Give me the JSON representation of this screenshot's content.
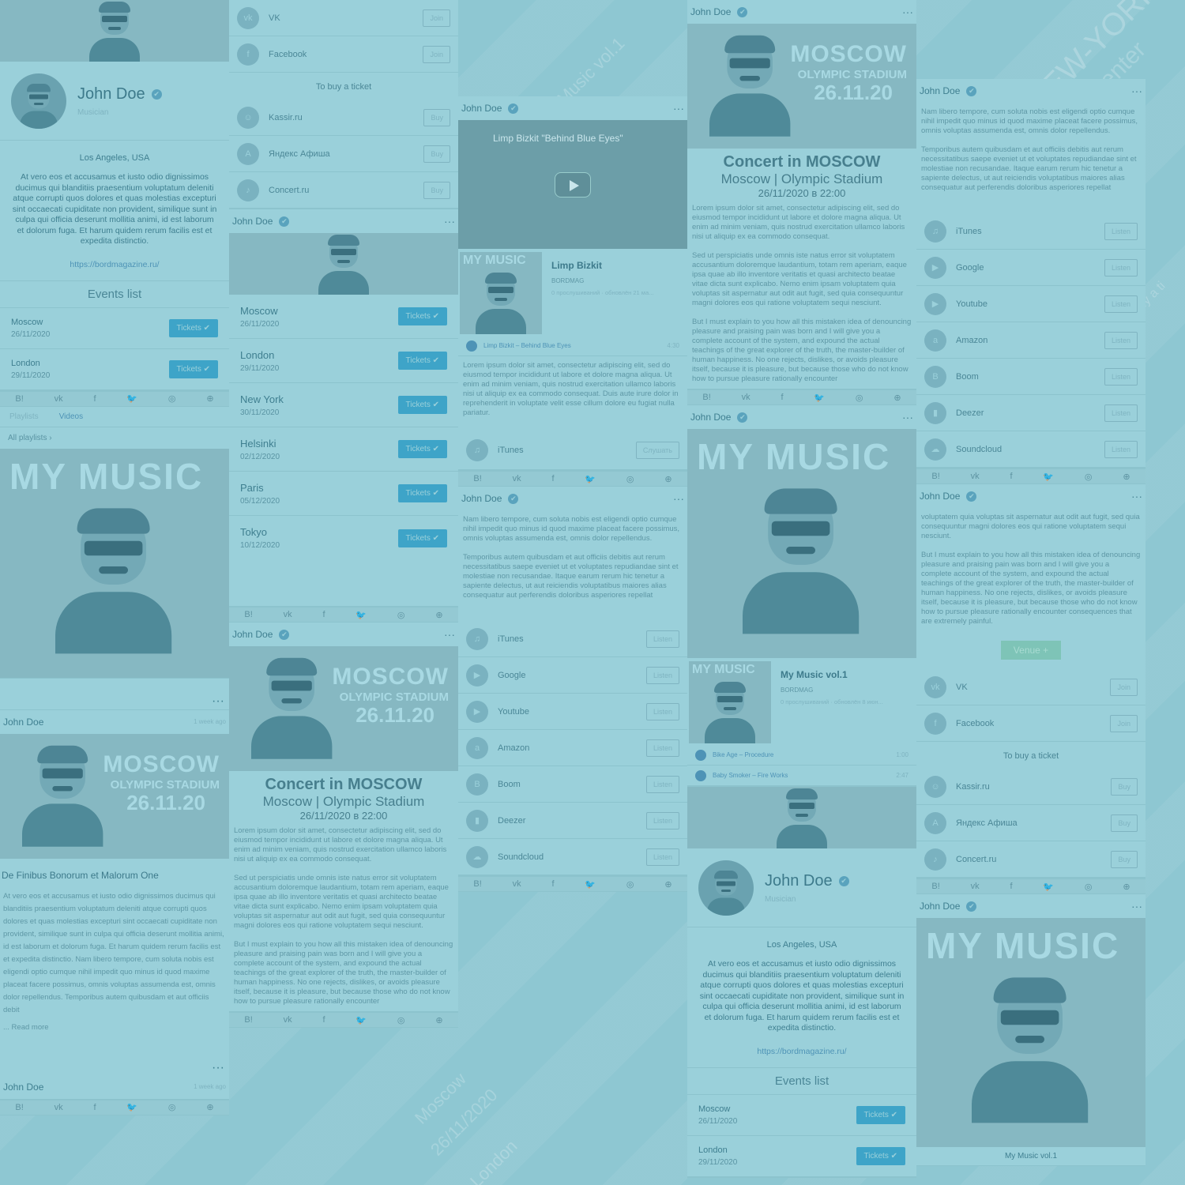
{
  "profile": {
    "name": "John Doe",
    "role": "Musician",
    "location": "Los Angeles, USA",
    "bio": "At vero eos et accusamus et iusto odio dignissimos ducimus qui blanditiis praesentium voluptatum deleniti atque corrupti quos dolores et quas molestias excepturi sint occaecati cupiditate non provident, similique sunt in culpa qui officia deserunt mollitia animi, id est laborum et dolorum fuga. Et harum quidem rerum facilis est et expedita distinctio.",
    "link": "https://bordmagazine.ru/",
    "verified_glyph": "✔"
  },
  "events": {
    "title": "Events list",
    "button_label": "Tickets ✔",
    "items": [
      {
        "city": "Moscow",
        "date": "26/11/2020"
      },
      {
        "city": "London",
        "date": "29/11/2020"
      },
      {
        "city": "New York",
        "date": "30/11/2020"
      },
      {
        "city": "Helsinki",
        "date": "02/12/2020"
      },
      {
        "city": "Paris",
        "date": "05/12/2020"
      },
      {
        "city": "Tokyo",
        "date": "10/12/2020"
      }
    ]
  },
  "social_icons": [
    "bord-icon",
    "vk-icon",
    "facebook-icon",
    "twitter-icon",
    "instagram-icon",
    "login-icon"
  ],
  "social_glyphs": [
    "B!",
    "vk",
    "f",
    "🐦",
    "◎",
    "⊕"
  ],
  "tabs": {
    "playlists": "Playlists",
    "videos": "Videos",
    "all_playlists": "All playlists ›"
  },
  "my_music": {
    "title": "MY MUSIC",
    "album": "My Music vol.1",
    "label": "BORDMAG",
    "meta_a": "0 прослушиваний · обновлён 8 июн...",
    "meta_b": "0 прослушиваний · обновлён 21 ма...",
    "tracks": [
      {
        "title": "Bike Age – Procedure",
        "time": "1:00"
      },
      {
        "title": "Baby Smoker – Fire Works",
        "time": "2:47"
      }
    ]
  },
  "post": {
    "author": "John Doe",
    "time_ago": "1 week ago",
    "more": "···",
    "article_title": "De Finibus Bonorum et Malorum One",
    "article_body": "At vero eos et accusamus et iusto odio dignissimos ducimus qui blanditiis praesentium voluptatum deleniti atque corrupti quos dolores et quas molestias excepturi sint occaecati cupiditate non provident, similique sunt in culpa qui officia deserunt mollitia animi, id est laborum et dolorum fuga. Et harum quidem rerum facilis est et expedita distinctio. Nam libero tempore, cum soluta nobis est eligendi optio cumque nihil impedit quo minus id quod maxime placeat facere possimus, omnis voluptas assumenda est, omnis dolor repellendus. Temporibus autem quibusdam et aut officiis debit",
    "read_more": "... Read more"
  },
  "communities": {
    "join_label": "Join",
    "items": [
      {
        "name": "VK",
        "icon": "vk-icon"
      },
      {
        "name": "Facebook",
        "icon": "facebook-icon"
      }
    ]
  },
  "tickets": {
    "title": "To buy a ticket",
    "buy_label": "Buy",
    "items": [
      {
        "name": "Kassir.ru",
        "icon": "kassir-icon"
      },
      {
        "name": "Яндекс Афиша",
        "icon": "yandex-afisha-icon"
      },
      {
        "name": "Concert.ru",
        "icon": "concert-icon"
      }
    ]
  },
  "concert": {
    "poster_city": "MOSCOW",
    "poster_venue": "OLYMPIC STADIUM",
    "poster_date": "26.11.20",
    "title": "Concert in MOSCOW",
    "subtitle": "Moscow | Olympic Stadium",
    "datetime": "26/11/2020 в 22:00",
    "p1": "Lorem ipsum dolor sit amet, consectetur adipiscing elit, sed do eiusmod tempor incididunt ut labore et dolore magna aliqua. Ut enim ad minim veniam, quis nostrud exercitation ullamco laboris nisi ut aliquip ex ea commodo consequat.",
    "p2": "Sed ut perspiciatis unde omnis iste natus error sit voluptatem accusantium doloremque laudantium, totam rem aperiam, eaque ipsa quae ab illo inventore veritatis et quasi architecto beatae vitae dicta sunt explicabo. Nemo enim ipsam voluptatem quia voluptas sit aspernatur aut odit aut fugit, sed quia consequuntur magni dolores eos qui ratione voluptatem sequi nesciunt.",
    "p3": "But I must explain to you how all this mistaken idea of denouncing pleasure and praising pain was born and I will give you a complete account of the system, and expound the actual teachings of the great explorer of the truth, the master-builder of human happiness. No one rejects, dislikes, or avoids pleasure itself, because it is pleasure, but because those who do not know how to pursue pleasure rationally encounter"
  },
  "video": {
    "title": "Limp Bizkit \"Behind Blue Eyes\"",
    "artist": "Limp Bizkit",
    "label": "BORDMAG",
    "meta": "0 прослушиваний · обновлён 21 ма...",
    "track": "Limp Bizkit – Behind Blue Eyes",
    "track_time": "4:30"
  },
  "video_desc": "Lorem ipsum dolor sit amet, consectetur adipiscing elit, sed do eiusmod tempor incididunt ut labore et dolore magna aliqua. Ut enim ad minim veniam, quis nostrud exercitation ullamco laboris nisi ut aliquip ex ea commodo consequat. Duis aute irure dolor in reprehenderit in voluptate velit esse cillum dolore eu fugiat nulla pariatur.",
  "about": {
    "p1": "Nam libero tempore, cum soluta nobis est eligendi optio cumque nihil impedit quo minus id quod maxime placeat facere possimus, omnis voluptas assumenda est, omnis dolor repellendus.",
    "p2": "Temporibus autem quibusdam et aut officiis debitis aut rerum necessitatibus saepe eveniet ut et voluptates repudiandae sint et molestiae non recusandae. Itaque earum rerum hic tenetur a sapiente delectus, ut aut reiciendis voluptatibus maiores alias consequatur aut perferendis doloribus asperiores repellat",
    "p3": "voluptatem quia voluptas sit aspernatur aut odit aut fugit, sed quia consequuntur magni dolores eos qui ratione voluptatem sequi nesciunt.",
    "p4": "But I must explain to you how all this mistaken idea of denouncing pleasure and praising pain was born and I will give you a complete account of the system, and expound the actual teachings of the great explorer of the truth, the master-builder of human happiness. No one rejects, dislikes, or avoids pleasure itself, because it is pleasure, but because those who do not know how to pursue pleasure rationally encounter consequences that are extremely painful."
  },
  "streaming": {
    "listen_label": "Listen",
    "listen_ru": "Слушать",
    "items": [
      {
        "name": "iTunes",
        "icon": "itunes-icon",
        "glyph": "♫"
      },
      {
        "name": "Google",
        "icon": "google-play-icon",
        "glyph": "▶"
      },
      {
        "name": "Youtube",
        "icon": "youtube-icon",
        "glyph": "▶"
      },
      {
        "name": "Amazon",
        "icon": "amazon-icon",
        "glyph": "a"
      },
      {
        "name": "Boom",
        "icon": "boom-icon",
        "glyph": "B"
      },
      {
        "name": "Deezer",
        "icon": "deezer-icon",
        "glyph": "▮"
      },
      {
        "name": "Soundcloud",
        "icon": "soundcloud-icon",
        "glyph": "☁"
      }
    ]
  },
  "venue_button": "Venue +",
  "background_text": [
    "Music vol.1",
    "NEW-YORK",
    "Center",
    "Moscow",
    "26/11/2020",
    "London",
    "29/11/2020",
    "York",
    "Tickets ✔",
    "buy a ti"
  ],
  "colors": {
    "background": "#8ec7d2",
    "accent": "#3ea4c8",
    "panel": "#9ad0da"
  }
}
